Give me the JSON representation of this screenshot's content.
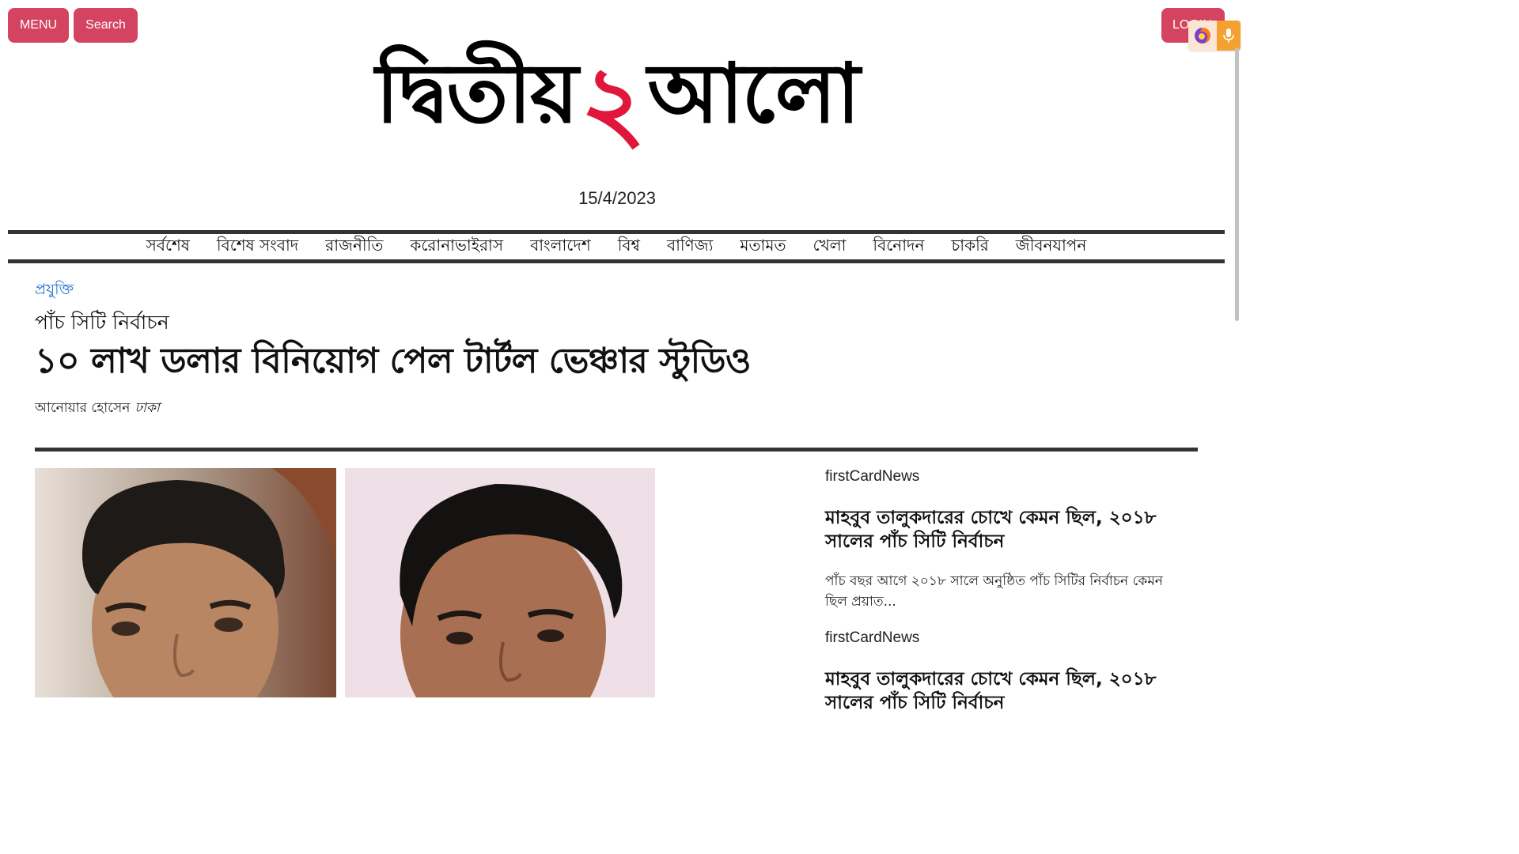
{
  "header": {
    "menu_label": "MENU",
    "search_label": "Search",
    "login_label": "LOGIN",
    "logo": {
      "left": "দ্বিতীয়",
      "middle": "২",
      "right": "আলো"
    },
    "date": "15/4/2023"
  },
  "nav": {
    "items": [
      "সর্বশেষ",
      "বিশেষ সংবাদ",
      "রাজনীতি",
      "করোনাভাইরাস",
      "বাংলাদেশ",
      "বিশ্ব",
      "বাণিজ্য",
      "মতামত",
      "খেলা",
      "বিনোদন",
      "চাকরি",
      "জীবনযাপন"
    ]
  },
  "article": {
    "category": "প্রযুক্তি",
    "kicker": "পাঁচ সিটি নির্বাচন",
    "headline": "১০ লাখ ডলার বিনিয়োগ পেল টার্টল ভেঞ্চার স্টুডিও",
    "author": "আনোয়ার হোসেন",
    "location": "ঢাকা"
  },
  "sidebar": {
    "cards": [
      {
        "label": "firstCardNews",
        "title": "মাহবুব তালুকদারের চোখে কেমন ছিল, ২০১৮ সালের পাঁচ সিটি নির্বাচন",
        "summary": "পাঁচ বছর আগে ২০১৮ সালে অনুষ্ঠিত পাঁচ সিটির নির্বাচন কেমন ছিল প্রয়াত..."
      },
      {
        "label": "firstCardNews",
        "title": "মাহবুব তালুকদারের চোখে কেমন ছিল, ২০১৮ সালের পাঁচ সিটি নির্বাচন"
      }
    ]
  },
  "colors": {
    "button": "#d44460",
    "logo_accent": "#e0173b",
    "category_link": "#1f6fd1",
    "rule": "#333333"
  },
  "icons": [
    "firefox-icon",
    "microphone-icon"
  ]
}
